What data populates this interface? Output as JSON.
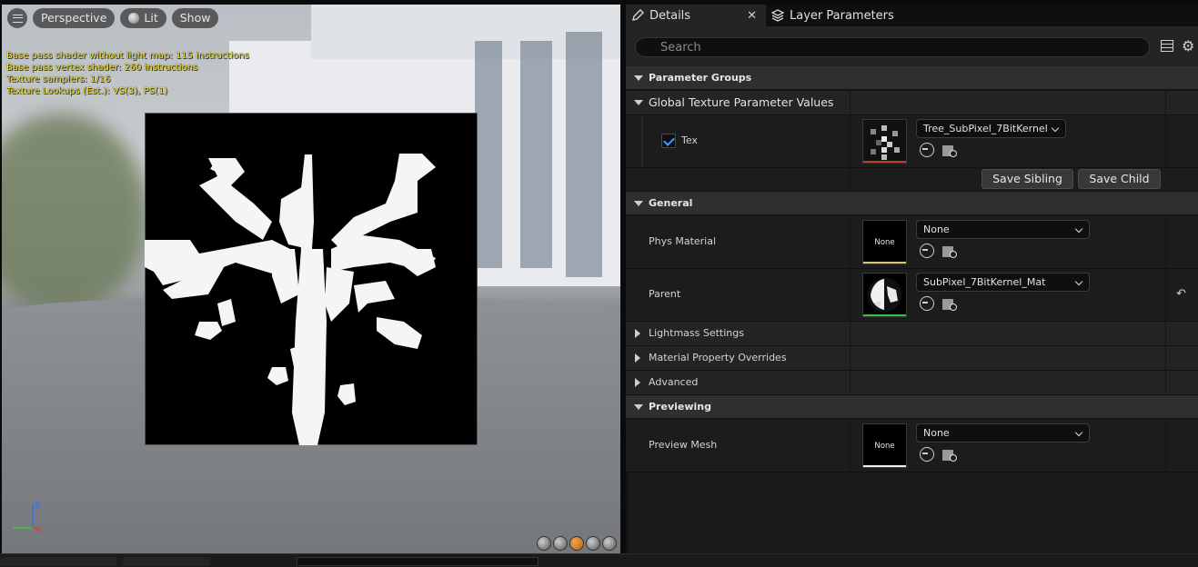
{
  "viewport": {
    "toolbar": {
      "perspective_label": "Perspective",
      "lit_label": "Lit",
      "show_label": "Show"
    },
    "stats": [
      "Base pass shader without light map: 115 instructions",
      "Base pass vertex shader: 260 instructions",
      "Texture samplers: 1/16",
      "Texture Lookups (Est.): VS(3), PS(1)"
    ],
    "axis": {
      "z_label": "Z",
      "x_label": "X"
    }
  },
  "tabs": [
    {
      "label": "Details",
      "icon": "pencil-icon",
      "active": true
    },
    {
      "label": "Layer Parameters",
      "icon": "layers-icon",
      "active": false
    }
  ],
  "search": {
    "placeholder": "Search",
    "value": ""
  },
  "details": {
    "parameter_groups_label": "Parameter Groups",
    "global_texture_label": "Global Texture Parameter Values",
    "tex": {
      "label": "Tex",
      "checked": true,
      "asset": "Tree_SubPixel_7BitKernel"
    },
    "save_sibling_label": "Save Sibling",
    "save_child_label": "Save Child",
    "general_label": "General",
    "phys_material": {
      "label": "Phys Material",
      "thumb_text": "None",
      "value": "None"
    },
    "parent": {
      "label": "Parent",
      "value": "SubPixel_7BitKernel_Mat"
    },
    "lightmass_label": "Lightmass Settings",
    "material_overrides_label": "Material Property Overrides",
    "advanced_label": "Advanced",
    "previewing_label": "Previewing",
    "preview_mesh": {
      "label": "Preview Mesh",
      "thumb_text": "None",
      "value": "None"
    }
  },
  "colors": {
    "accent_checkbox": "#3a9cff",
    "stats_text": "#f2e23b",
    "texture_bar": "#c0392b",
    "phys_bar": "#d8c870",
    "parent_bar": "#35c03a",
    "preview_bar": "#f0f0f0"
  }
}
